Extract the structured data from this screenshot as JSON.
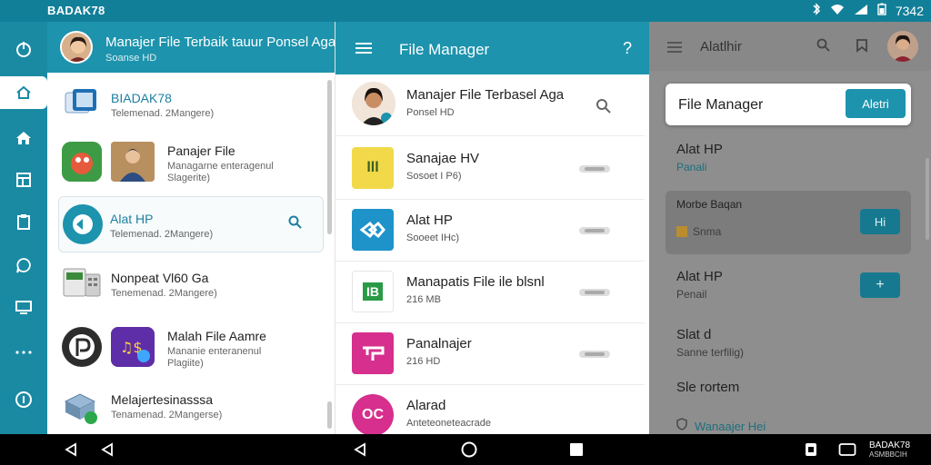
{
  "status_bar": {
    "brand": "BADAK78",
    "time": "7342",
    "icons": [
      "bluetooth-icon",
      "wifi-icon",
      "signal-icon",
      "battery-icon"
    ]
  },
  "rail": {
    "icons": [
      "power-icon",
      "home-outline-icon",
      "home-icon",
      "layout-icon",
      "clipboard-icon",
      "chat-icon",
      "monitor-icon",
      "more-icon",
      "info-icon"
    ],
    "active_index": 1
  },
  "left_panel": {
    "header": {
      "title": "Manajer File Terbaik tauur Ponsel Aga",
      "subtitle": "Soanse HD"
    },
    "items": [
      {
        "title": "BIADAK78",
        "sub": "Telemenad. 2Mangere)"
      },
      {
        "title": "Panajer File",
        "sub": "Managarne enteragenul",
        "sub2": "Slagerite)"
      },
      {
        "title": "Alat HP",
        "sub": "Telemenad. 2Mangere)"
      },
      {
        "title": "Nonpeat Vl60 Ga",
        "sub": "Tenemenad. 2Mangere)"
      },
      {
        "title": "Malah File Aamre",
        "sub": "Mananie enteranenul",
        "sub2": "Plagiite)"
      },
      {
        "title": "Melajertesinasssa",
        "sub": "Tenamenad. 2Mangerse)"
      }
    ]
  },
  "main_panel": {
    "header": {
      "title": "File Manager",
      "help": "?"
    },
    "top_item": {
      "title": "Manajer File Terbasel Aga",
      "sub": "Ponsel HD"
    },
    "rows": [
      {
        "title": "Sanajae HV",
        "sub": "Sosoet I P6)",
        "badge": "lll",
        "color": "#f2d94a",
        "fg": "#3a5d1f"
      },
      {
        "title": "Alat HP",
        "sub": "Sooeet IHc)",
        "badge": "",
        "color": "#1d93c9",
        "fg": "#fff"
      },
      {
        "title": "Manapatis File ile blsnl",
        "sub": "216 MB",
        "badge": "IB",
        "color": "#ffffff",
        "fg": "#2a9a46"
      },
      {
        "title": "Panalnajer",
        "sub": "216 HD",
        "badge": "",
        "color": "#d62f8e",
        "fg": "#fff"
      },
      {
        "title": "Alarad",
        "sub": "Anteteoneteacrade",
        "badge": "OC",
        "color": "#d62f8e",
        "fg": "#fff"
      }
    ]
  },
  "right_panel": {
    "header": {
      "title": "Alatlhir"
    },
    "card": {
      "text": "File Manager",
      "button": "Aletri"
    },
    "sections": [
      {
        "title": "Alat HP",
        "sub": "Panali"
      },
      {
        "title": "Morbe Baqan",
        "sub": "Snma",
        "button": "Hi"
      },
      {
        "title": "Alat HP",
        "sub": "Penail",
        "button": "+"
      },
      {
        "title": "Slat d",
        "sub": "Sanne terfilig)"
      },
      {
        "title": "Sle rortem",
        "sub": ""
      },
      {
        "title": "Wanaajer Hei",
        "sub": ""
      }
    ]
  },
  "nav_bar": {
    "brand_line1": "BADAK78",
    "brand_line2": "ASMBBCIH"
  }
}
